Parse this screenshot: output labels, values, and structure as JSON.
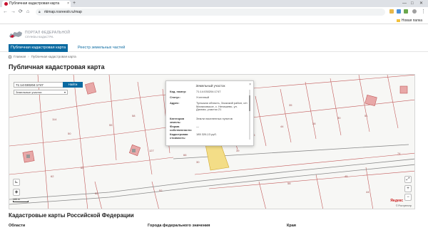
{
  "browser": {
    "tab_title": "Публичная кадастровая карта",
    "tab_close": "×",
    "new_tab": "+",
    "url": "rkimap.rosreestr.ru/map",
    "bookmarks_label": "Новая папка"
  },
  "site": {
    "logo_line1": "Портал Федеральной",
    "logo_line2": "службы кадастра"
  },
  "menu": {
    "items": [
      {
        "label": "Публичная кадастровая карта",
        "active": true
      },
      {
        "label": "Реестр земельных частей",
        "active": false
      }
    ]
  },
  "breadcrumbs": {
    "home": "Главная",
    "current": "Публичная кадастровая карта"
  },
  "page_title": "Публичная кадастровая карта",
  "map": {
    "search_value": "71:14:030204:1747",
    "search_button": "Найти",
    "type_select": "Земельные участки",
    "scale_label": "100 m",
    "copyright": "© Ростреестр",
    "provider": "Яндекс",
    "parcel_labels": [
      "50",
      "55",
      "58",
      "62",
      "65",
      "66",
      "39",
      "127",
      "30",
      "44",
      "28",
      "30",
      "51",
      "35",
      "74",
      "52",
      "52",
      "114",
      "58",
      "45",
      "44",
      "46"
    ]
  },
  "popup": {
    "title": "Земельный участок",
    "close": "×",
    "rows": [
      {
        "key": "Кад. номер:",
        "value": "71:14:030204:1747"
      },
      {
        "key": "Статус:",
        "value": "Учтенный"
      },
      {
        "key": "Адрес:",
        "value": "Тульская область, Заокский район, с/п Малаховское, с. Ненашево, ул. Дачная, участок 21"
      },
      {
        "key": "Категория земель:",
        "value": "Земли населенных пунктов"
      },
      {
        "key": "Форма собственности:",
        "value": "—"
      },
      {
        "key": "Кадастровая стоимость:",
        "value": "185 326,13 руб."
      }
    ]
  },
  "footer": {
    "section_title": "Кадастровые карты Российской Федерации",
    "columns": [
      "Области",
      "Города федерального значения",
      "Края"
    ]
  }
}
